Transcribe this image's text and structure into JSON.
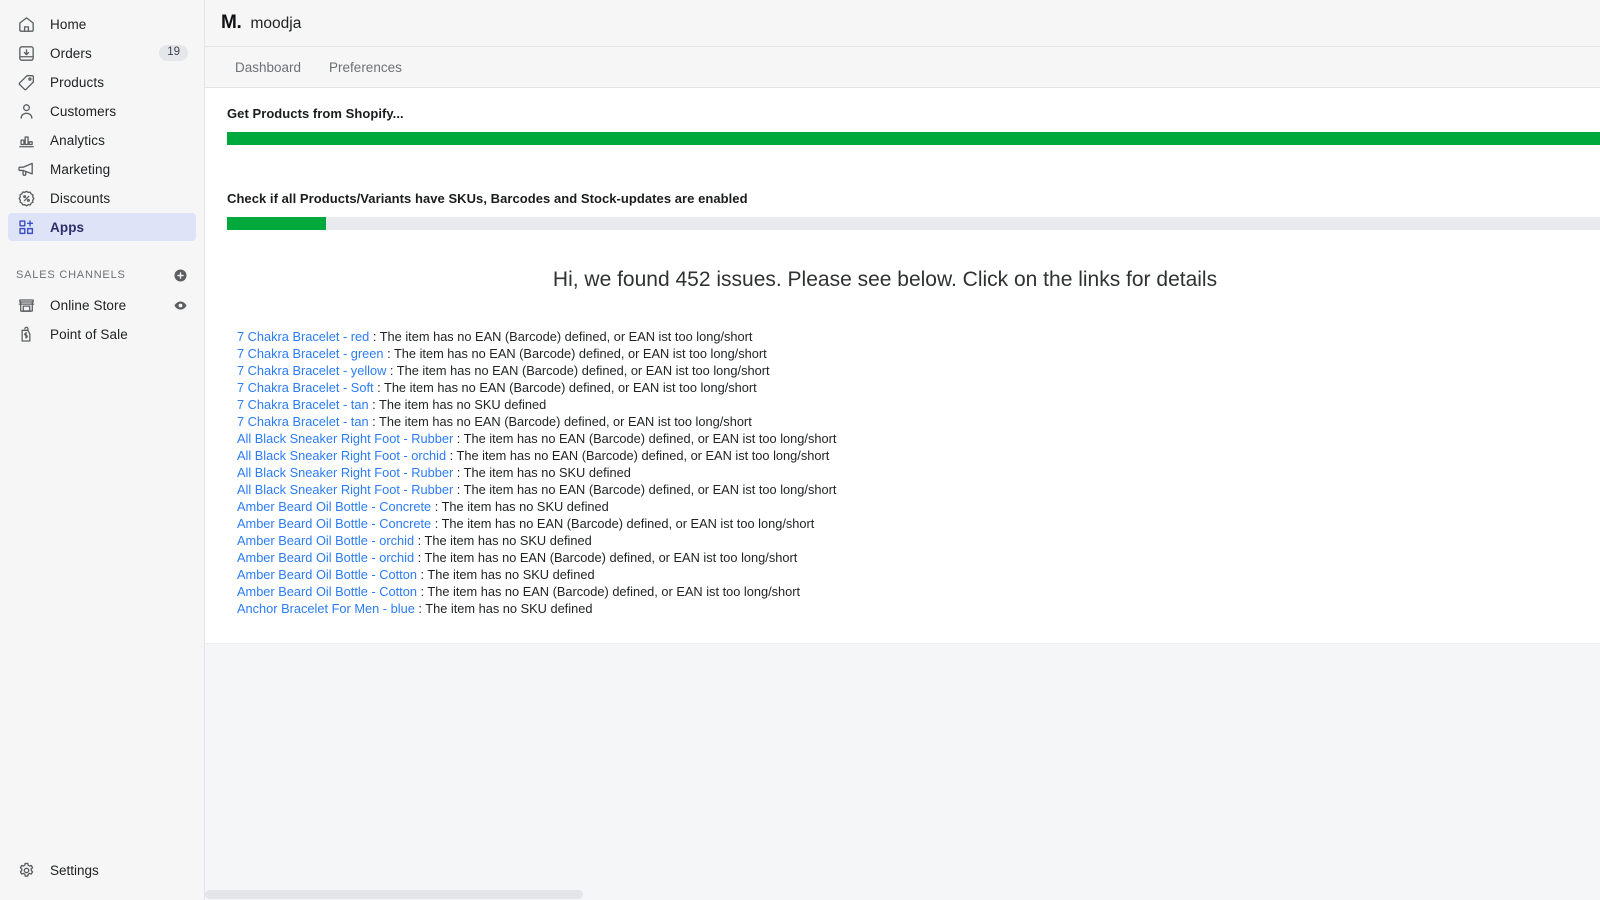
{
  "sidebar": {
    "items": [
      {
        "label": "Home",
        "icon": "home-icon",
        "badge": null
      },
      {
        "label": "Orders",
        "icon": "orders-inbox-icon",
        "badge": "19"
      },
      {
        "label": "Products",
        "icon": "tag-icon",
        "badge": null
      },
      {
        "label": "Customers",
        "icon": "person-icon",
        "badge": null
      },
      {
        "label": "Analytics",
        "icon": "bar-chart-icon",
        "badge": null
      },
      {
        "label": "Marketing",
        "icon": "megaphone-icon",
        "badge": null
      },
      {
        "label": "Discounts",
        "icon": "percent-badge-icon",
        "badge": null
      },
      {
        "label": "Apps",
        "icon": "apps-grid-plus-icon",
        "badge": null
      }
    ],
    "section_title": "SALES CHANNELS",
    "channels": [
      {
        "label": "Online Store",
        "icon": "storefront-icon",
        "trailing_icon": "eye-icon"
      },
      {
        "label": "Point of Sale",
        "icon": "pos-bag-icon",
        "trailing_icon": null
      }
    ],
    "settings": {
      "label": "Settings",
      "icon": "gear-icon"
    }
  },
  "header": {
    "brand_mark": "M.",
    "brand_name": "moodja"
  },
  "tabs": [
    {
      "label": "Dashboard"
    },
    {
      "label": "Preferences"
    }
  ],
  "progress": [
    {
      "label": "Get Products from Shopify...",
      "percent": 100
    },
    {
      "label": "Check if all Products/Variants have SKUs, Barcodes and Stock-updates are enabled",
      "percent": 7
    }
  ],
  "headline": "Hi, we found 452 issues. Please see below. Click on the links for details",
  "issue_count": 452,
  "colors": {
    "progress_fill": "#00a93c",
    "progress_track": "#e8eaed",
    "link": "#2b7cf6",
    "active_nav_bg": "#dfe3f7",
    "sidebar_bg": "#f6f6f7",
    "page_bg": "#f4f6f8"
  },
  "issues": [
    {
      "link": "7 Chakra Bracelet - red",
      "sep": " : ",
      "message": "The item has no EAN (Barcode) defined, or EAN ist too long/short"
    },
    {
      "link": "7 Chakra Bracelet - green",
      "sep": " : ",
      "message": "The item has no EAN (Barcode) defined, or EAN ist too long/short"
    },
    {
      "link": "7 Chakra Bracelet - yellow",
      "sep": " : ",
      "message": "The item has no EAN (Barcode) defined, or EAN ist too long/short"
    },
    {
      "link": "7 Chakra Bracelet - Soft",
      "sep": " : ",
      "message": "The item has no EAN (Barcode) defined, or EAN ist too long/short"
    },
    {
      "link": "7 Chakra Bracelet - tan",
      "sep": " : ",
      "message": "The item has no SKU defined"
    },
    {
      "link": "7 Chakra Bracelet - tan",
      "sep": " : ",
      "message": "The item has no EAN (Barcode) defined, or EAN ist too long/short"
    },
    {
      "link": "All Black Sneaker Right Foot - Rubber",
      "sep": " : ",
      "message": "The item has no EAN (Barcode) defined, or EAN ist too long/short"
    },
    {
      "link": "All Black Sneaker Right Foot - orchid",
      "sep": " : ",
      "message": "The item has no EAN (Barcode) defined, or EAN ist too long/short"
    },
    {
      "link": "All Black Sneaker Right Foot - Rubber",
      "sep": " : ",
      "message": "The item has no SKU defined"
    },
    {
      "link": "All Black Sneaker Right Foot - Rubber",
      "sep": " : ",
      "message": "The item has no EAN (Barcode) defined, or EAN ist too long/short"
    },
    {
      "link": "Amber Beard Oil Bottle - Concrete",
      "sep": " : ",
      "message": "The item has no SKU defined"
    },
    {
      "link": "Amber Beard Oil Bottle - Concrete",
      "sep": " : ",
      "message": "The item has no EAN (Barcode) defined, or EAN ist too long/short"
    },
    {
      "link": "Amber Beard Oil Bottle - orchid",
      "sep": " : ",
      "message": "The item has no SKU defined"
    },
    {
      "link": "Amber Beard Oil Bottle - orchid",
      "sep": " : ",
      "message": "The item has no EAN (Barcode) defined, or EAN ist too long/short"
    },
    {
      "link": "Amber Beard Oil Bottle - Cotton",
      "sep": " : ",
      "message": "The item has no SKU defined"
    },
    {
      "link": "Amber Beard Oil Bottle - Cotton",
      "sep": " : ",
      "message": "The item has no EAN (Barcode) defined, or EAN ist too long/short"
    },
    {
      "link": "Anchor Bracelet For Men - blue",
      "sep": " : ",
      "message": "The item has no SKU defined"
    }
  ]
}
